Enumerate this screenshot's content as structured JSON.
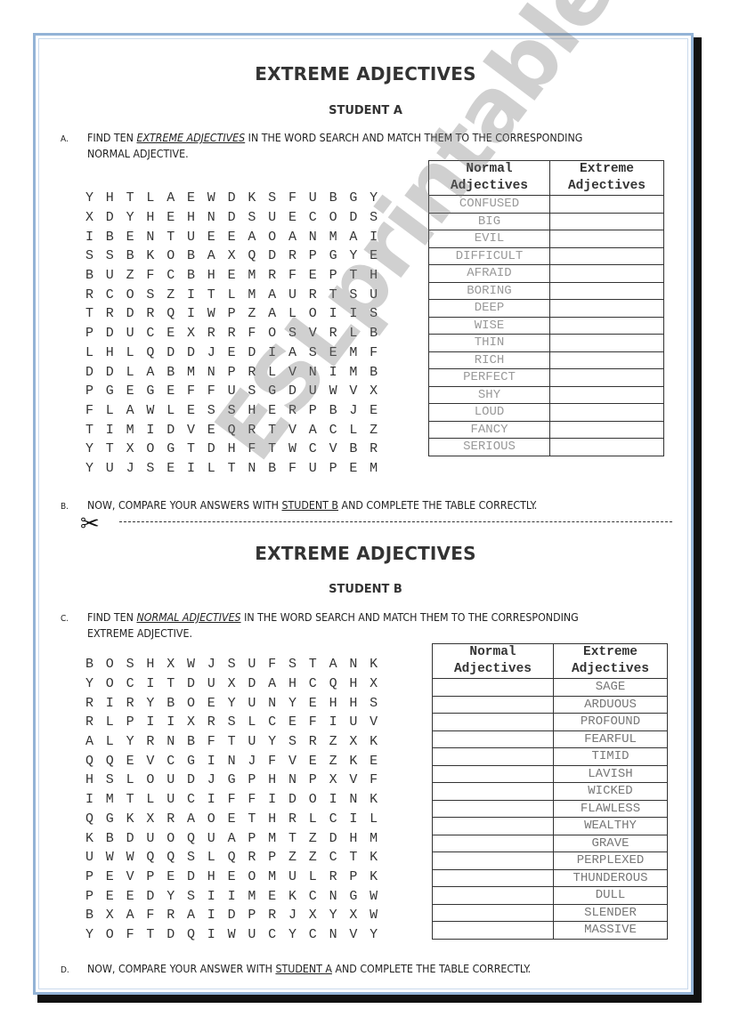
{
  "student_a": {
    "title": "EXTREME ADJECTIVES",
    "subtitle": "STUDENT A",
    "instruction_a": {
      "letter": "A.",
      "pre": "FIND TEN ",
      "emphasis": "EXTREME ADJECTIVES",
      "post": " IN THE WORD SEARCH AND MATCH THEM TO THE CORRESPONDING",
      "line2": "NORMAL ADJECTIVE."
    },
    "grid": [
      "YHTLAEWDKSFUBGY",
      "XDYHEHNDSUECODS",
      "IBENTUEEAOANMAI",
      "SSBKOBAXQDRPGYE",
      "BUZFCBHEMRFEPTH",
      "RCOSZITLMAURTSU",
      "TRDRQIWPZALOIIS",
      "PDUCEXRRFOSVRLB",
      "LHLQDDJEDIASEMF",
      "DDLABMNPRLVNIMB",
      "PGEGEFFUSGDUWVX",
      "FLAWLESSHERPBJE",
      "TIMIDVEQRTVACLZ",
      "YTXOGTDHFTWCVBR",
      "YUJSEILTNBFUPEM"
    ],
    "table": {
      "headers": [
        [
          "Normal",
          "Adjectives"
        ],
        [
          "Extreme",
          "Adjectives"
        ]
      ],
      "rows": [
        [
          "CONFUSED",
          ""
        ],
        [
          "BIG",
          ""
        ],
        [
          "EVIL",
          ""
        ],
        [
          "DIFFICULT",
          ""
        ],
        [
          "AFRAID",
          ""
        ],
        [
          "BORING",
          ""
        ],
        [
          "DEEP",
          ""
        ],
        [
          "WISE",
          ""
        ],
        [
          "THIN",
          ""
        ],
        [
          "RICH",
          ""
        ],
        [
          "PERFECT",
          ""
        ],
        [
          "SHY",
          ""
        ],
        [
          "LOUD",
          ""
        ],
        [
          "FANCY",
          ""
        ],
        [
          "SERIOUS",
          ""
        ]
      ]
    },
    "instruction_b": {
      "letter": "B.",
      "pre": "NOW, COMPARE YOUR ANSWERS WITH ",
      "emphasis": "STUDENT B",
      "post": " AND COMPLETE THE TABLE CORRECTLY."
    }
  },
  "cut_line": {
    "icon": "✂"
  },
  "student_b": {
    "title": "EXTREME ADJECTIVES",
    "subtitle": "STUDENT B",
    "instruction_c": {
      "letter": "C.",
      "pre": "FIND TEN ",
      "emphasis": "NORMAL ADJECTIVES",
      "post": " IN THE WORD SEARCH AND MATCH THEM TO THE CORRESPONDING",
      "line2": "EXTREME ADJECTIVE."
    },
    "grid": [
      "BOSHXWJSUFSTANK",
      "YOCITDUXDAHCQHX",
      "RIRYBOEYUNYEHHS",
      "RLPIIXRSLCEFIUV",
      "ALYRNBFTUYSRZXK",
      "QQEVCGINJFVEZKE",
      "HSLOUDJGPHNPXVF",
      "IMTLUCIFFIDOINK",
      "QGKXRAOETHRLCIL",
      "KBDUOQUAPMTZDHM",
      "UWWQQSLQRPZZCTK",
      "PEVPEDHEOMULRPK",
      "PEEDYSIIMEKCNGW",
      "BXAFRAIDPRJXYXW",
      "YOFTDQIWUCYCNVY"
    ],
    "table": {
      "headers": [
        [
          "Normal",
          "Adjectives"
        ],
        [
          "Extreme",
          "Adjectives"
        ]
      ],
      "rows": [
        [
          "",
          "SAGE"
        ],
        [
          "",
          "ARDUOUS"
        ],
        [
          "",
          "PROFOUND"
        ],
        [
          "",
          "FEARFUL"
        ],
        [
          "",
          "TIMID"
        ],
        [
          "",
          "LAVISH"
        ],
        [
          "",
          "WICKED"
        ],
        [
          "",
          "FLAWLESS"
        ],
        [
          "",
          "WEALTHY"
        ],
        [
          "",
          "GRAVE"
        ],
        [
          "",
          "PERPLEXED"
        ],
        [
          "",
          "THUNDEROUS"
        ],
        [
          "",
          "DULL"
        ],
        [
          "",
          "SLENDER"
        ],
        [
          "",
          "MASSIVE"
        ]
      ]
    },
    "instruction_d": {
      "letter": "D.",
      "pre": "NOW, COMPARE YOUR ANSWER WITH ",
      "emphasis": "STUDENT A",
      "post": " AND COMPLETE THE TABLE CORRECTLY."
    }
  },
  "watermark": {
    "text": "ESLprintables.com"
  }
}
